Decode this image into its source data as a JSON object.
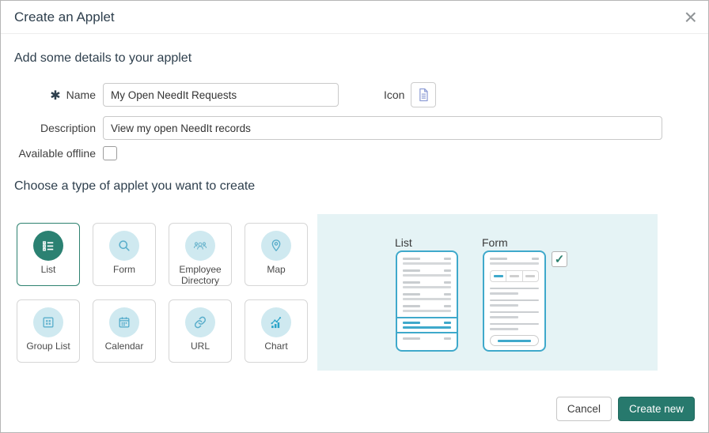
{
  "dialog": {
    "title": "Create an Applet",
    "close_glyph": "×"
  },
  "details_section": {
    "heading": "Add some details to your applet",
    "name_field": {
      "label": "Name",
      "required_marker": "✱",
      "value": "My Open NeedIt Requests"
    },
    "icon_field": {
      "label": "Icon",
      "icon": "document-icon"
    },
    "description_field": {
      "label": "Description",
      "value": "View my open NeedIt records"
    },
    "available_offline": {
      "label": "Available offline",
      "checked": false
    }
  },
  "type_section": {
    "heading": "Choose a type of applet you want to create",
    "tiles": [
      {
        "label": "List",
        "icon": "list-icon",
        "selected": true
      },
      {
        "label": "Form",
        "icon": "search-icon",
        "selected": false
      },
      {
        "label": "Employee Directory",
        "icon": "people-icon",
        "selected": false
      },
      {
        "label": "Map",
        "icon": "map-pin-icon",
        "selected": false
      },
      {
        "label": "Group List",
        "icon": "grid-icon",
        "selected": false
      },
      {
        "label": "Calendar",
        "icon": "calendar-icon",
        "selected": false
      },
      {
        "label": "URL",
        "icon": "link-icon",
        "selected": false
      },
      {
        "label": "Chart",
        "icon": "chart-icon",
        "selected": false
      }
    ]
  },
  "preview": {
    "list_label": "List",
    "form_label": "Form",
    "checkbox_checked": true,
    "checkbox_glyph": "✓"
  },
  "footer": {
    "cancel_label": "Cancel",
    "create_label": "Create new"
  },
  "colors": {
    "accent_teal": "#2b8172",
    "tile_icon_blue": "#5aaecb",
    "tile_circle_bg": "#cfe9f0",
    "chart_icon_blue": "#2aa3c8",
    "doc_icon_purple": "#8f9ed6",
    "preview_bg": "#e5f3f5",
    "mockup_blue": "#3fa9cb"
  }
}
